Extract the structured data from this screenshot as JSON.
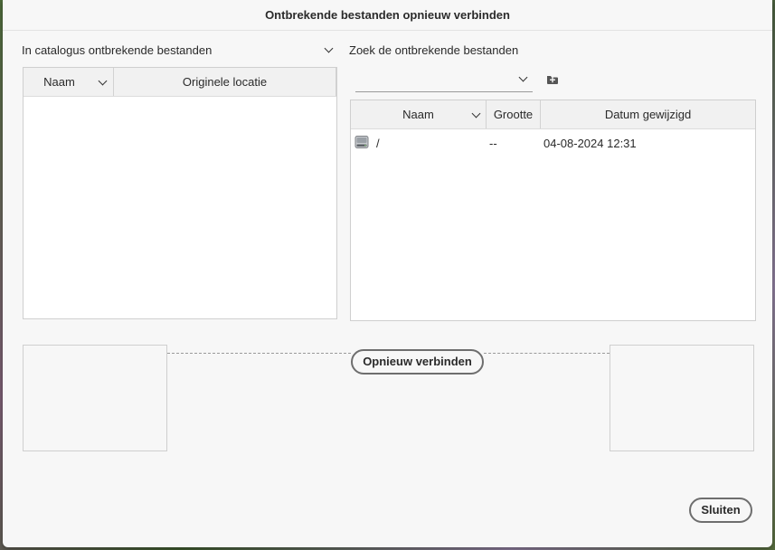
{
  "dialog": {
    "title": "Ontbrekende bestanden opnieuw verbinden"
  },
  "left": {
    "dropdown_label": "In catalogus ontbrekende bestanden",
    "columns": [
      "Naam",
      "Originele locatie"
    ]
  },
  "right": {
    "header_label": "Zoek de ontbrekende bestanden",
    "location_value": "",
    "columns": [
      "Naam",
      "Grootte",
      "Datum gewijzigd"
    ],
    "rows": [
      {
        "icon": "disk-drive-icon",
        "name": "/",
        "size": "--",
        "date": "04-08-2024 12:31"
      }
    ]
  },
  "actions": {
    "relink_label": "Opnieuw verbinden",
    "close_label": "Sluiten"
  }
}
